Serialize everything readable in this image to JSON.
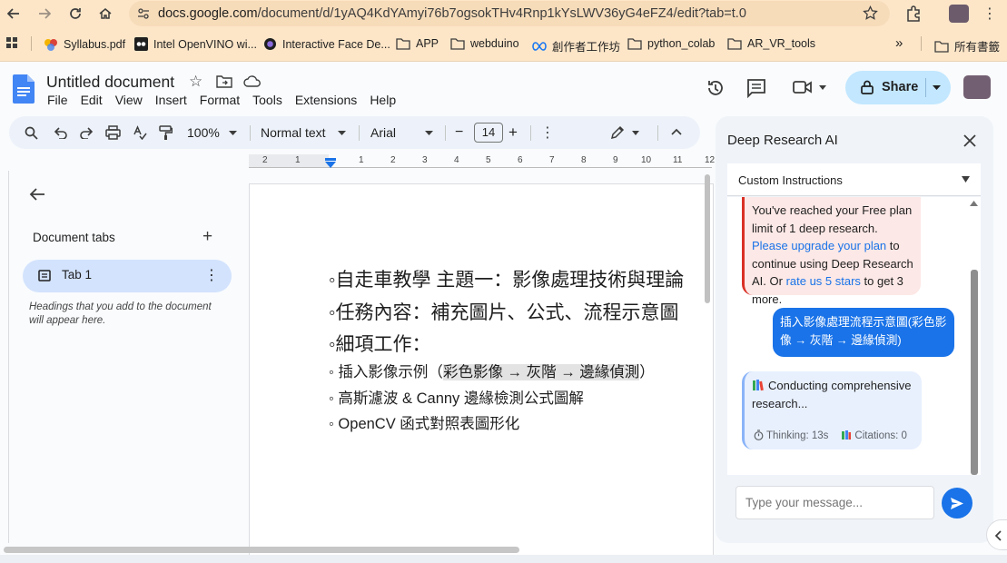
{
  "browser": {
    "url_host": "docs.google.com",
    "url_path": "/document/d/1yAQ4KdYAmyi76b7ogsokTHv4Rnp1kYsLWV36yG4eFZ4/edit?tab=t.0",
    "bookmarks": [
      "Syllabus.pdf",
      "Intel OpenVINO wi...",
      "Interactive Face De...",
      "APP",
      "webduino",
      "創作者工作坊",
      "python_colab",
      "AR_VR_tools"
    ],
    "bookmarks_more": "»",
    "all_bookmarks": "所有書籤"
  },
  "docs": {
    "title": "Untitled document",
    "menu": [
      "File",
      "Edit",
      "View",
      "Insert",
      "Format",
      "Tools",
      "Extensions",
      "Help"
    ],
    "share_label": "Share"
  },
  "toolbar": {
    "zoom": "100%",
    "style": "Normal text",
    "font": "Arial",
    "font_size": "14",
    "minus": "−",
    "plus": "+"
  },
  "ruler": {
    "labels": [
      "2",
      "1",
      "1",
      "2",
      "3",
      "4",
      "5",
      "6",
      "7",
      "8",
      "9",
      "10",
      "11",
      "12"
    ]
  },
  "tabs_panel": {
    "title": "Document tabs",
    "tab_label": "Tab 1",
    "hint": "Headings that you add to the document will appear here."
  },
  "document": {
    "line1": "◦自走車教學 主題一：影像處理技術與理論",
    "line2": "◦任務內容：補充圖片、公式、流程示意圖",
    "line3": "◦細項工作：",
    "line4_pre": "◦ 插入影像示例（",
    "line4_hl": "彩色影像 → 灰階 → 邊緣偵測",
    "line4_post": "）",
    "line5": "◦ 高斯濾波 & Canny 邊緣檢測公式圖解",
    "line6": "◦ OpenCV 函式對照表圖形化"
  },
  "ai_panel": {
    "title": "Deep Research AI",
    "custom_instructions": "Custom Instructions",
    "warn_1": "You've reached your Free plan limit of 1 deep research. ",
    "warn_link1": "Please upgrade your plan",
    "warn_2": " to continue using Deep Research AI. Or ",
    "warn_link2": "rate us 5 stars",
    "warn_3": " to get 3 more.",
    "user_message": "插入影像處理流程示意圖(彩色影像 → 灰階 → 邊緣偵測)",
    "bot_message": "Conducting comprehensive research...",
    "thinking": "Thinking: 13s",
    "citations": "Citations: 0",
    "input_placeholder": "Type your message..."
  },
  "colors": {
    "accent": "#1a73e8",
    "chrome": "#fde6c8",
    "share": "#c2e7ff",
    "warn_bg": "#fce8e6",
    "warn_border": "#d93025"
  }
}
